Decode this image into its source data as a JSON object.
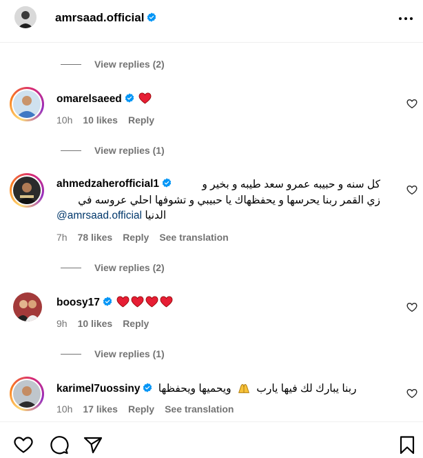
{
  "header": {
    "username": "amrsaad.official",
    "verified": true
  },
  "reply_toggles": [
    {
      "label": "View replies (2)"
    },
    {
      "label": "View replies (1)"
    },
    {
      "label": "View replies (2)"
    },
    {
      "label": "View replies (1)"
    }
  ],
  "comments": [
    {
      "username": "omarelsaeed",
      "verified": true,
      "emoji": [
        "red-heart"
      ],
      "time": "10h",
      "likes": "10 likes",
      "reply": "Reply"
    },
    {
      "username": "ahmedzaherofficial1",
      "verified": true,
      "text_line1": "كل سنه و حبيبه عمرو سعد طيبه و بخير و",
      "text_line2": "زي القمر ربنا يحرسها و يحفظهاك يا حبيبي و تشوفها احلي عروسه في",
      "text_line3_word": "الدنيا",
      "mention": "@amrsaad.official",
      "time": "7h",
      "likes": "78 likes",
      "reply": "Reply",
      "see_translation": "See translation"
    },
    {
      "username": "boosy17",
      "verified": true,
      "emoji": [
        "red-heart",
        "red-heart",
        "red-heart",
        "red-heart"
      ],
      "time": "9h",
      "likes": "10 likes",
      "reply": "Reply"
    },
    {
      "username": "karimel7uossiny",
      "verified": true,
      "text_part1": "ويحميها ويحفظها",
      "text_part2": "ربنا يبارك لك فيها يارب",
      "emoji_mid": "folded-hands",
      "time": "10h",
      "likes": "17 likes",
      "reply": "Reply",
      "see_translation": "See translation"
    }
  ],
  "colors": {
    "verified_blue": "#0095f6",
    "secondary_text": "#737373",
    "heart_red": "#ff3040",
    "mention_blue": "#00376b"
  },
  "action_icons": [
    "heart-outline-icon",
    "comment-bubble-icon",
    "share-plane-icon",
    "bookmark-icon"
  ]
}
